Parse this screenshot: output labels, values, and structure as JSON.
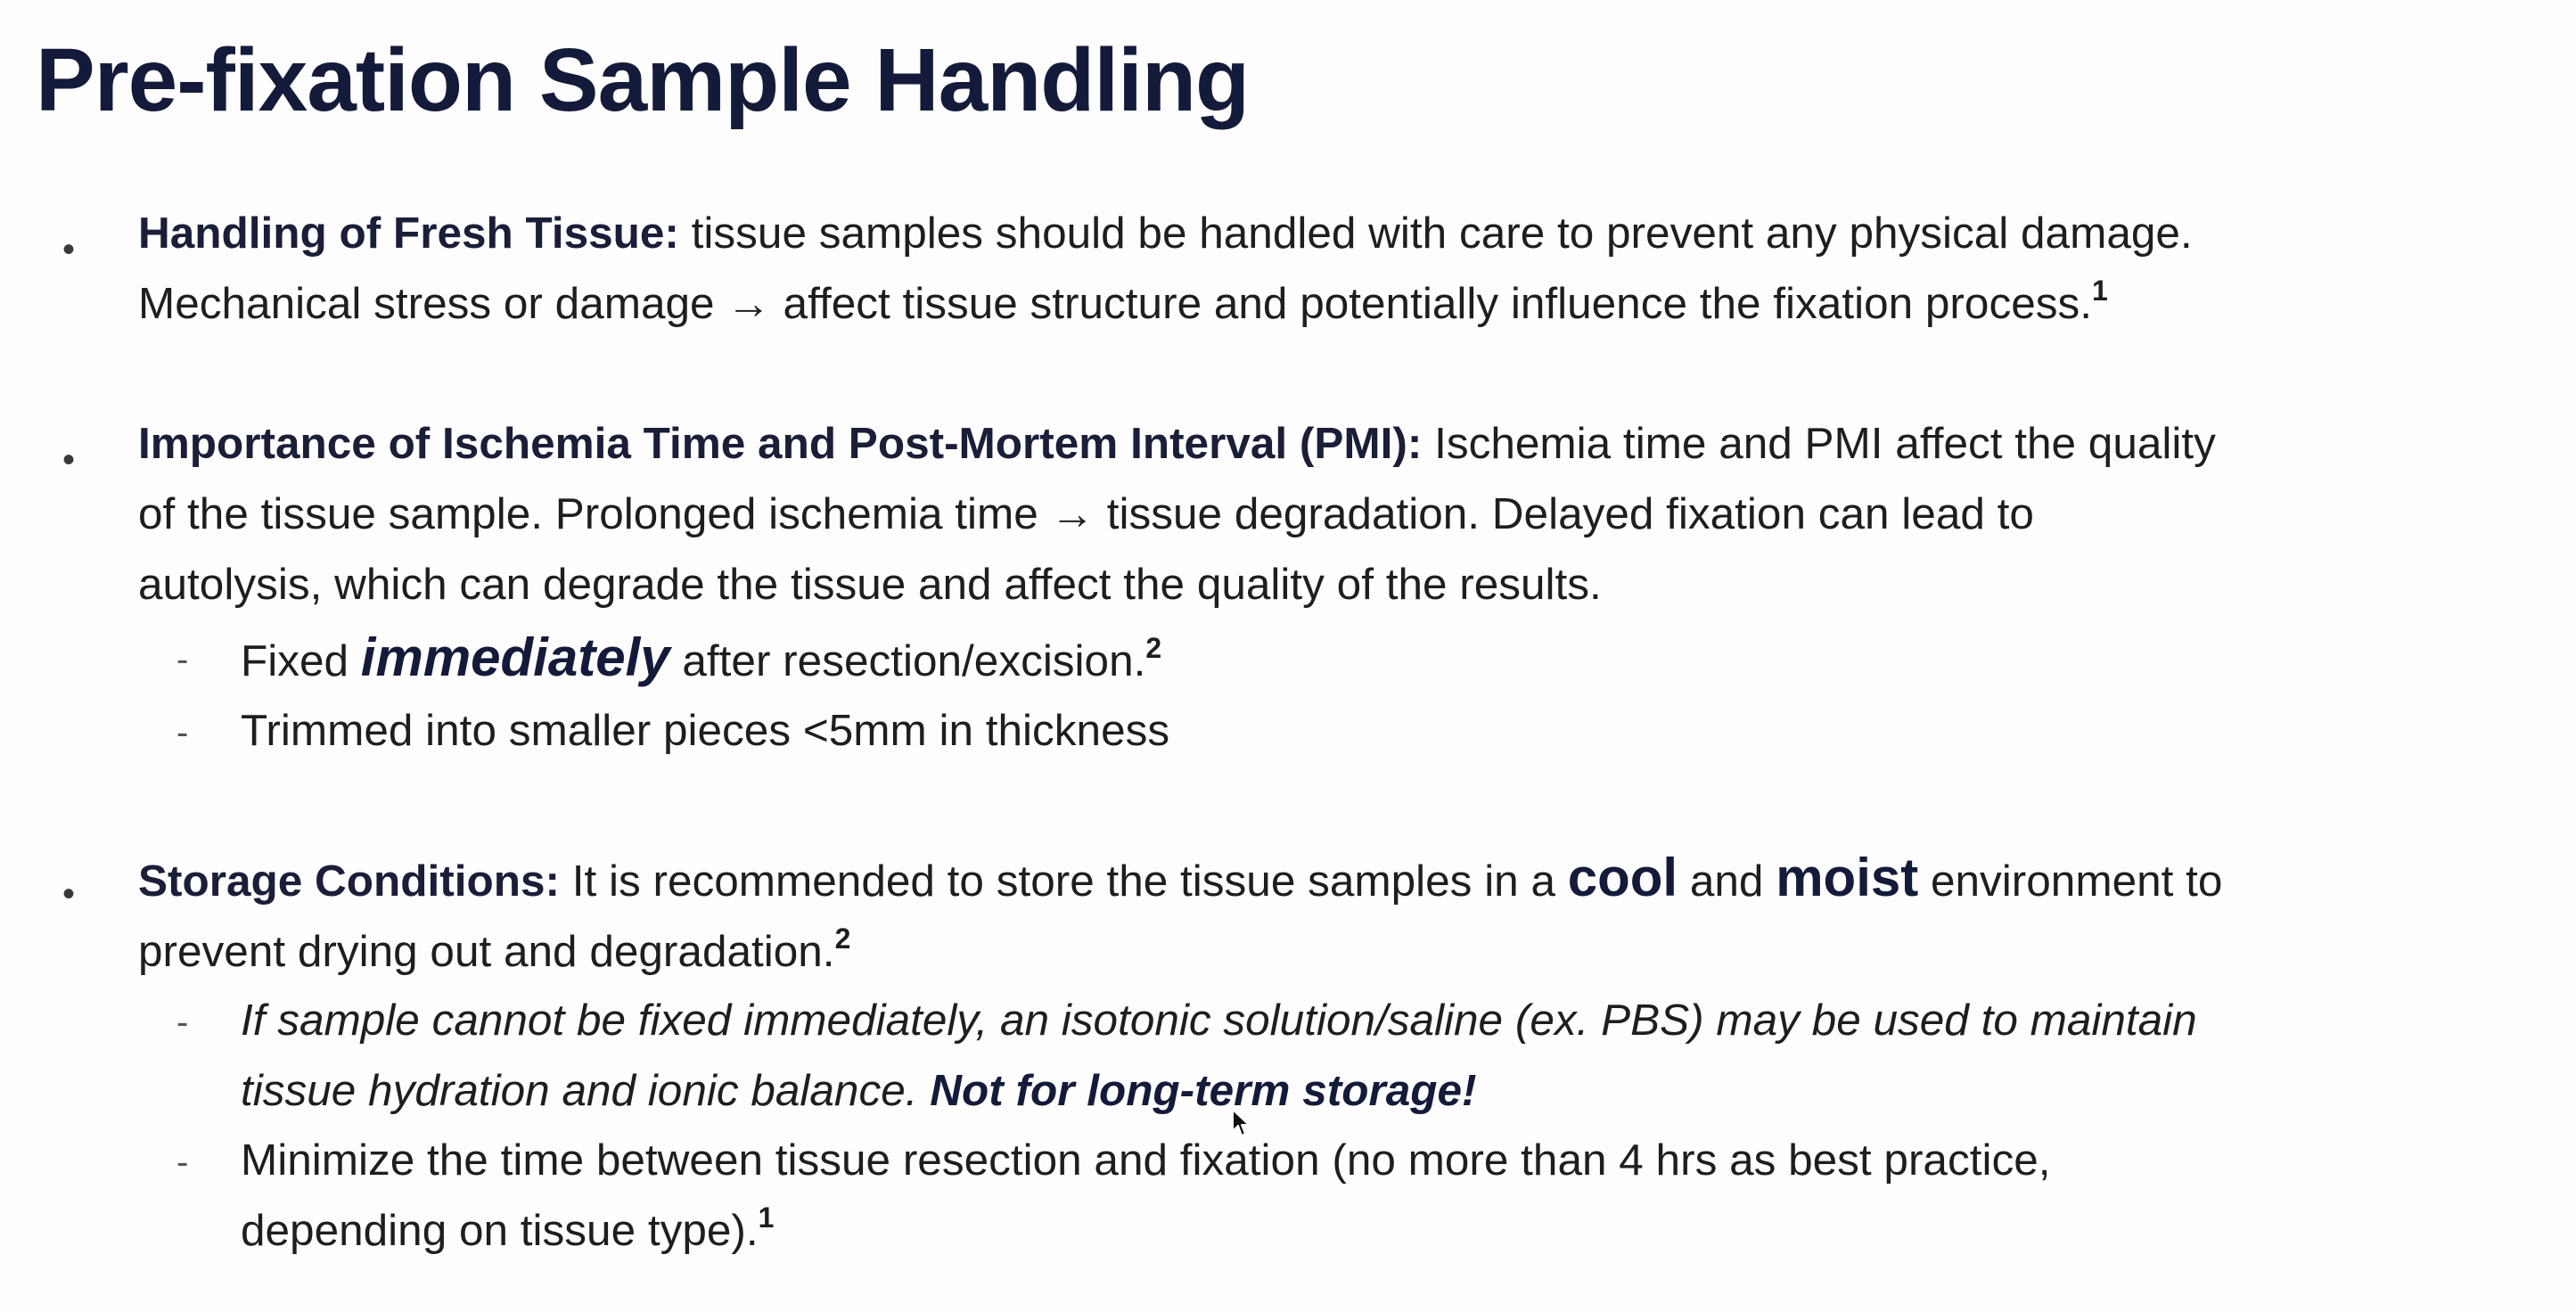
{
  "slide": {
    "title": "Pre-fixation Sample Handling",
    "bullets": [
      {
        "marker": "•",
        "heading": "Handling of Fresh Tissue:",
        "line1": " tissue samples should be handled with care to prevent any physical damage.",
        "line2": "Mechanical stress or damage → affect tissue structure and potentially influence the fixation process.",
        "ref": "1"
      },
      {
        "marker": "•",
        "heading": "Importance of Ischemia Time and Post-Mortem Interval (PMI):",
        "line1": " Ischemia time and PMI affect the quality",
        "line2": "of the tissue sample. Prolonged ischemia time → tissue degradation. Delayed fixation can lead to",
        "line3": "autolysis, which can degrade the tissue and affect the quality of the results.",
        "subs": [
          {
            "marker": "-",
            "pre": "Fixed ",
            "emph": "immediately",
            "post": " after resection/excision.",
            "ref": "2"
          },
          {
            "marker": "-",
            "text": "Trimmed into smaller pieces <5mm in thickness"
          }
        ]
      },
      {
        "marker": "•",
        "heading": "Storage Conditions:",
        "line1_pre": " It is recommended to store the tissue samples in a ",
        "cool": "cool",
        "and": " and ",
        "moist": "moist",
        "line1_post": " environment to",
        "line2": "prevent drying out and degradation.",
        "ref": "2",
        "subs": [
          {
            "marker": "-",
            "line1": "If sample cannot be fixed immediately, an isotonic solution/saline (ex. PBS) may be used to maintain",
            "line2": "tissue hydration and ionic balance. ",
            "emph": "Not for long-term storage!"
          },
          {
            "marker": "-",
            "line1": "Minimize the time between tissue resection and fixation (no more than 4 hrs as best practice,",
            "line2": "depending on tissue type).",
            "ref": "1"
          }
        ]
      }
    ]
  },
  "colors": {
    "title": "#141b3a",
    "body_text": "#1e1e1e",
    "background": "#fdfdfd"
  },
  "icons": {
    "cursor": "mouse-pointer-icon"
  }
}
